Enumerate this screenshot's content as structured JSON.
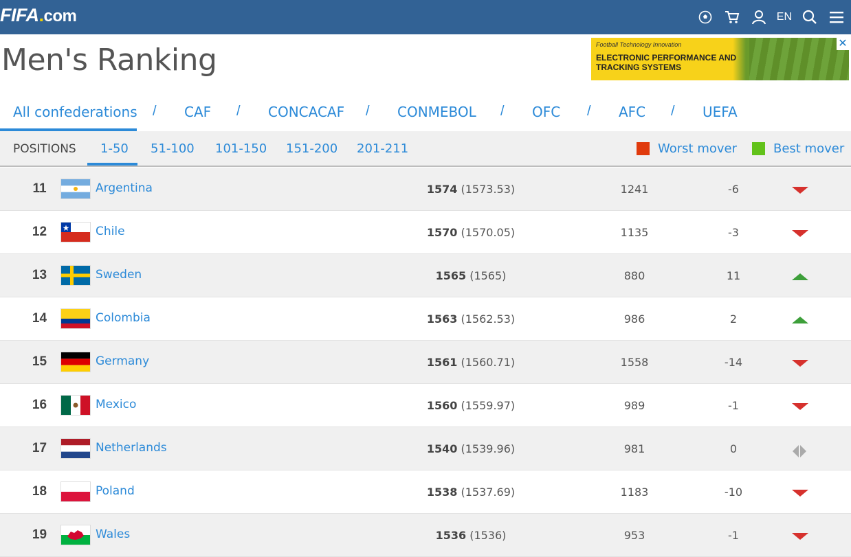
{
  "header": {
    "logo_main": "FIFA",
    "logo_suffix": "com",
    "language": "EN"
  },
  "page": {
    "title": "Men's Ranking"
  },
  "ad": {
    "tagline": "Football Technology Innovation",
    "headline": "ELECTRONIC PERFORMANCE AND TRACKING SYSTEMS"
  },
  "confederations": [
    "All confederations",
    "CAF",
    "CONCACAF",
    "CONMEBOL",
    "OFC",
    "AFC",
    "UEFA"
  ],
  "positions": {
    "label": "POSITIONS",
    "tabs": [
      "1-50",
      "51-100",
      "101-150",
      "151-200",
      "201-211"
    ],
    "active": "1-50"
  },
  "legend": {
    "worst": "Worst mover",
    "best": "Best mover",
    "worst_color": "#e03a0c",
    "best_color": "#62c21a"
  },
  "colors": {
    "header_bg": "#326295",
    "link": "#2c8ad8",
    "down_arrow": "#d6312d",
    "up_arrow": "#3d9f3a",
    "neutral_arrow": "#aaaaaa"
  },
  "rows": [
    {
      "rank": "11",
      "team": "Argentina",
      "flag": "argentina",
      "pts": "1574",
      "pts_exact": "(1573.53)",
      "prev": "1241",
      "move": "-6",
      "trend": "down"
    },
    {
      "rank": "12",
      "team": "Chile",
      "flag": "chile",
      "pts": "1570",
      "pts_exact": "(1570.05)",
      "prev": "1135",
      "move": "-3",
      "trend": "down"
    },
    {
      "rank": "13",
      "team": "Sweden",
      "flag": "sweden",
      "pts": "1565",
      "pts_exact": "(1565)",
      "prev": "880",
      "move": "11",
      "trend": "up"
    },
    {
      "rank": "14",
      "team": "Colombia",
      "flag": "colombia",
      "pts": "1563",
      "pts_exact": "(1562.53)",
      "prev": "986",
      "move": "2",
      "trend": "up"
    },
    {
      "rank": "15",
      "team": "Germany",
      "flag": "germany",
      "pts": "1561",
      "pts_exact": "(1560.71)",
      "prev": "1558",
      "move": "-14",
      "trend": "down"
    },
    {
      "rank": "16",
      "team": "Mexico",
      "flag": "mexico",
      "pts": "1560",
      "pts_exact": "(1559.97)",
      "prev": "989",
      "move": "-1",
      "trend": "down"
    },
    {
      "rank": "17",
      "team": "Netherlands",
      "flag": "netherlands",
      "pts": "1540",
      "pts_exact": "(1539.96)",
      "prev": "981",
      "move": "0",
      "trend": "same"
    },
    {
      "rank": "18",
      "team": "Poland",
      "flag": "poland",
      "pts": "1538",
      "pts_exact": "(1537.69)",
      "prev": "1183",
      "move": "-10",
      "trend": "down"
    },
    {
      "rank": "19",
      "team": "Wales",
      "flag": "wales",
      "pts": "1536",
      "pts_exact": "(1536)",
      "prev": "953",
      "move": "-1",
      "trend": "down"
    }
  ]
}
